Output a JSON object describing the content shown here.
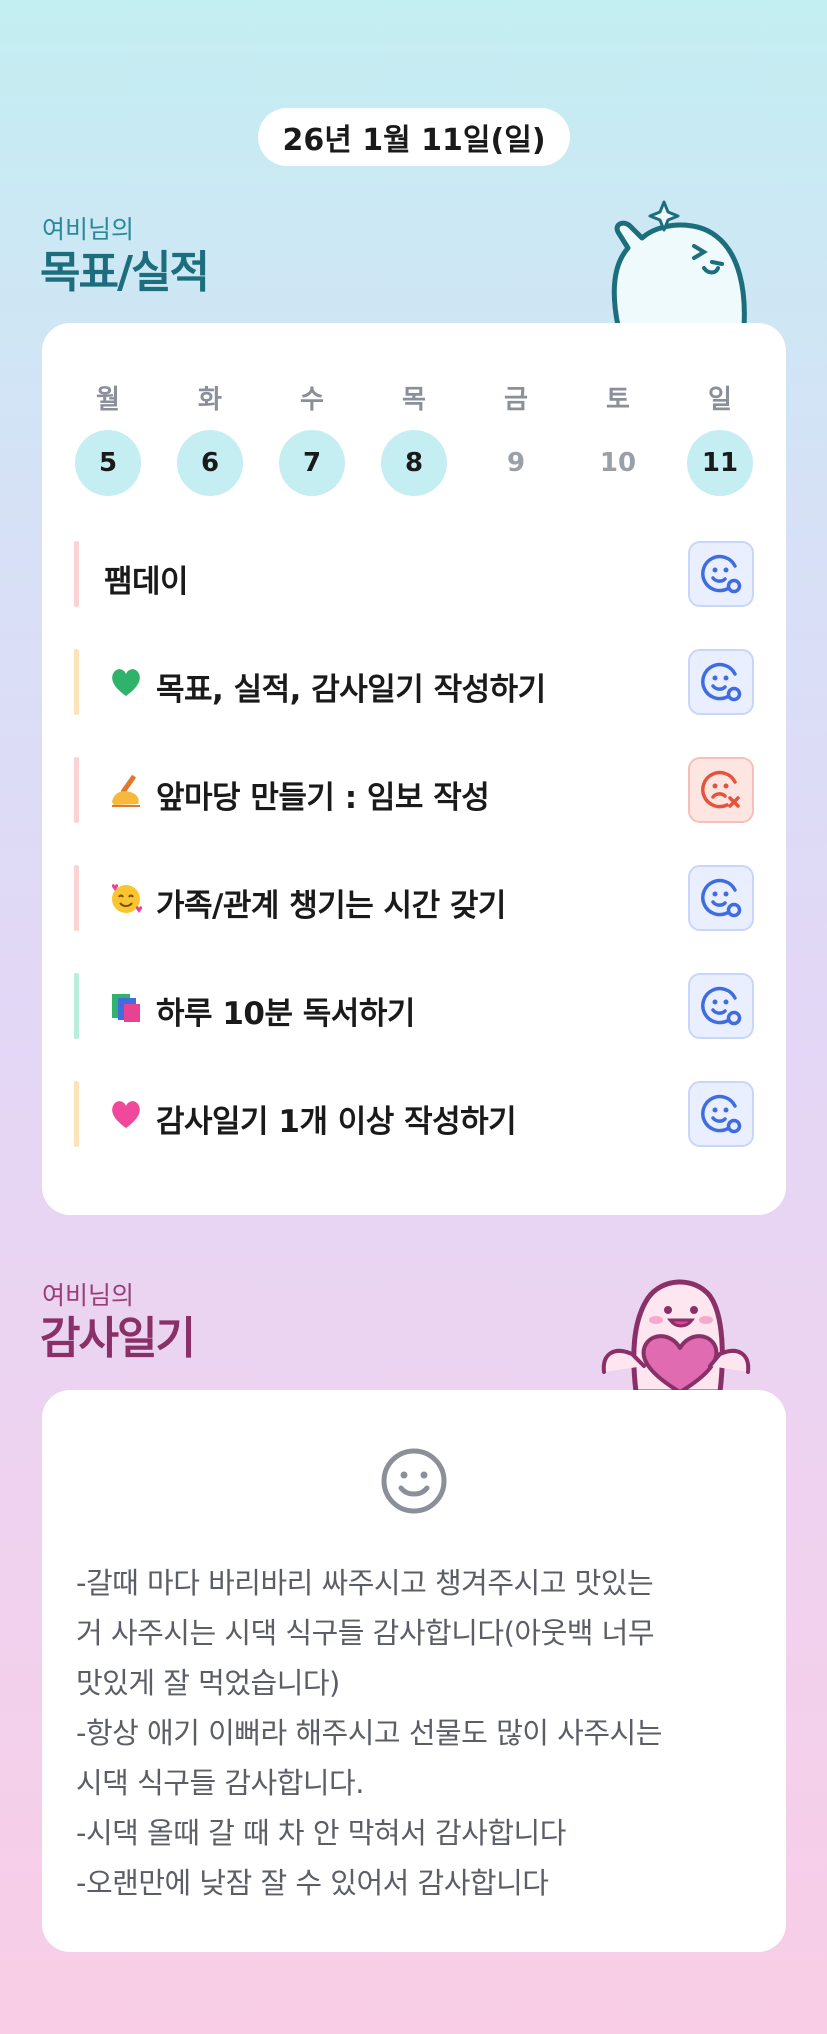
{
  "date_label": "26년 1월 11일(일)",
  "goals_section": {
    "subtitle": "여비님의",
    "title": "목표/실적",
    "weekdays": [
      "월",
      "화",
      "수",
      "목",
      "금",
      "토",
      "일"
    ],
    "days": [
      {
        "num": "5",
        "state": "done"
      },
      {
        "num": "6",
        "state": "done"
      },
      {
        "num": "7",
        "state": "done"
      },
      {
        "num": "8",
        "state": "done"
      },
      {
        "num": "9",
        "state": "empty"
      },
      {
        "num": "10",
        "state": "empty"
      },
      {
        "num": "11",
        "state": "done"
      }
    ],
    "goals": [
      {
        "text": "팸데이",
        "emoji": "",
        "bar_color": "#fbd3d3",
        "status": "good"
      },
      {
        "text": "목표, 실적, 감사일기 작성하기",
        "emoji": "green-heart-icon",
        "bar_color": "#fde4b8",
        "status": "good"
      },
      {
        "text": "앞마당 만들기 : 임보 작성",
        "emoji": "writing-hand-icon",
        "bar_color": "#fbd3d3",
        "status": "bad"
      },
      {
        "text": "가족/관계 챙기는 시간 갖기",
        "emoji": "smiling-face-with-hearts-icon",
        "bar_color": "#fbd3d3",
        "status": "good"
      },
      {
        "text": "하루 10분 독서하기",
        "emoji": "books-icon",
        "bar_color": "#b8eedb",
        "status": "good"
      },
      {
        "text": "감사일기 1개 이상 작성하기",
        "emoji": "pink-heart-icon",
        "bar_color": "#fde4b8",
        "status": "good"
      }
    ]
  },
  "gratitude_section": {
    "subtitle": "여비님의",
    "title": "감사일기",
    "mood_icon": "smile-face-icon",
    "text": "-갈때 마다 바리바리 싸주시고 챙겨주시고 맛있는\n거 사주시는 시댁 식구들 감사합니다(아웃백 너무\n맛있게 잘 먹었습니다)\n-항상 애기 이뻐라 해주시고 선물도 많이 사주시는\n시댁 식구들 감사합니다.\n-시댁 올때 갈 때 차 안 막혀서 감사합니다\n-오랜만에 낮잠 잘 수 있어서 감사합니다"
  },
  "colors": {
    "done_day": "#c5eef2",
    "good_icon": "#3f6de0",
    "bad_icon": "#e4543c",
    "goals_title": "#1d6e7c",
    "gratitude_title": "#8a3068"
  }
}
